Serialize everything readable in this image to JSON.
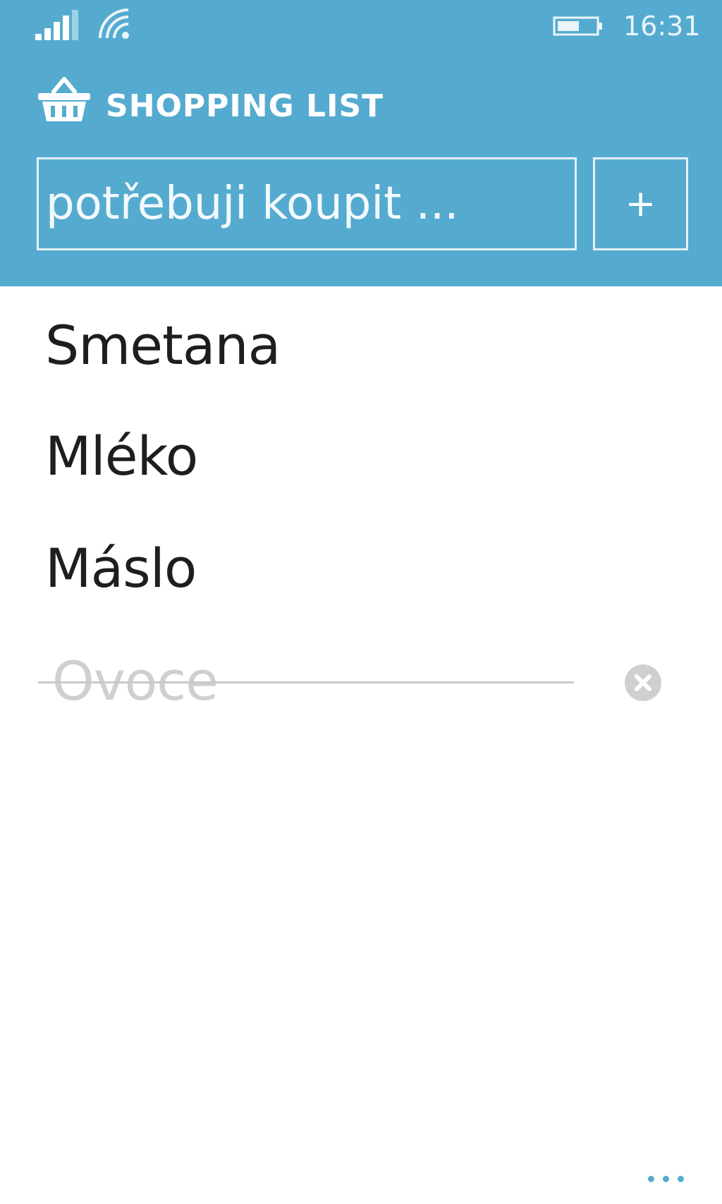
{
  "status_bar": {
    "time": "16:31",
    "icons": [
      "signal-icon",
      "wifi-icon",
      "battery-icon"
    ]
  },
  "header": {
    "title": "SHOPPING LIST",
    "logo_icon": "basket-icon",
    "background_color": "#55abcf"
  },
  "input": {
    "placeholder": "potřebuji koupit ...",
    "value": ""
  },
  "add_button": {
    "label": "+"
  },
  "items": [
    {
      "label": "Smetana",
      "done": false
    },
    {
      "label": "Mléko",
      "done": false
    },
    {
      "label": "Máslo",
      "done": false
    },
    {
      "label": "Ovoce",
      "done": true
    }
  ],
  "app_bar": {
    "more_icon": "ellipsis-icon"
  }
}
